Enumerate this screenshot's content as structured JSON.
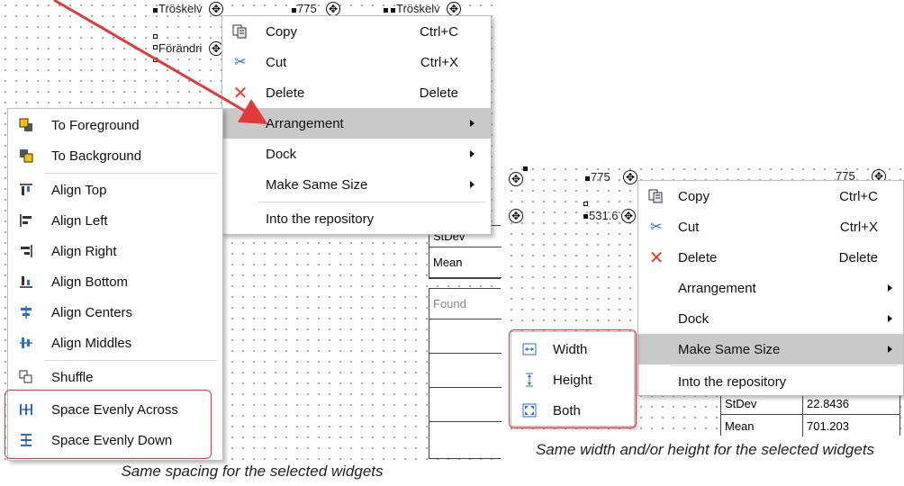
{
  "left_panel": {
    "widgets": {
      "threshold_label_1": "Tröskelv",
      "threshold_label_2": "Tröskelv",
      "change_label": "Förändri",
      "value_top": "775"
    },
    "table_cells": [
      "StDev",
      "Mean",
      "Found"
    ],
    "context_menu": [
      {
        "label": "Copy",
        "shortcut": "Ctrl+C",
        "icon": "copy-icon"
      },
      {
        "label": "Cut",
        "shortcut": "Ctrl+X",
        "icon": "scissors-icon"
      },
      {
        "label": "Delete",
        "shortcut": "Delete",
        "icon": "delete-x-icon"
      },
      {
        "label": "Arrangement",
        "submenu": true,
        "highlighted": true
      },
      {
        "label": "Dock",
        "submenu": true
      },
      {
        "label": "Make Same Size",
        "submenu": true
      },
      {
        "label": "Into the repository"
      }
    ],
    "arrangement_submenu": [
      {
        "label": "To Foreground",
        "icon": "to-foreground-icon"
      },
      {
        "label": "To Background",
        "icon": "to-background-icon"
      },
      {
        "label": "Align Top",
        "icon": "align-top-icon"
      },
      {
        "label": "Align Left",
        "icon": "align-left-icon"
      },
      {
        "label": "Align Right",
        "icon": "align-right-icon"
      },
      {
        "label": "Align Bottom",
        "icon": "align-bottom-icon"
      },
      {
        "label": "Align Centers",
        "icon": "align-centers-icon"
      },
      {
        "label": "Align Middles",
        "icon": "align-middles-icon"
      },
      {
        "label": "Shuffle",
        "icon": "shuffle-icon"
      },
      {
        "label": "Space Evenly Across",
        "icon": "space-across-icon"
      },
      {
        "label": "Space Evenly Down",
        "icon": "space-down-icon"
      }
    ],
    "caption": "Same spacing for the selected widgets"
  },
  "right_panel": {
    "widgets": {
      "value_1": "775",
      "value_2": "531.6",
      "value_3": "775"
    },
    "table": [
      {
        "label": "StDev",
        "value": "22.8436"
      },
      {
        "label": "Mean",
        "value": "701.203"
      }
    ],
    "context_menu": [
      {
        "label": "Copy",
        "shortcut": "Ctrl+C",
        "icon": "copy-icon"
      },
      {
        "label": "Cut",
        "shortcut": "Ctrl+X",
        "icon": "scissors-icon"
      },
      {
        "label": "Delete",
        "shortcut": "Delete",
        "icon": "delete-x-icon"
      },
      {
        "label": "Arrangement",
        "submenu": true
      },
      {
        "label": "Dock",
        "submenu": true
      },
      {
        "label": "Make Same Size",
        "submenu": true,
        "highlighted": true
      },
      {
        "label": "Into the repository"
      }
    ],
    "size_submenu": [
      {
        "label": "Width",
        "icon": "width-icon"
      },
      {
        "label": "Height",
        "icon": "height-icon"
      },
      {
        "label": "Both",
        "icon": "both-size-icon"
      }
    ],
    "caption": "Same width and/or height for the selected widgets"
  },
  "colors": {
    "highlight": "#c9c9c9",
    "annotation_red": "#e03a3a",
    "accent_blue": "#2a6fc9"
  }
}
